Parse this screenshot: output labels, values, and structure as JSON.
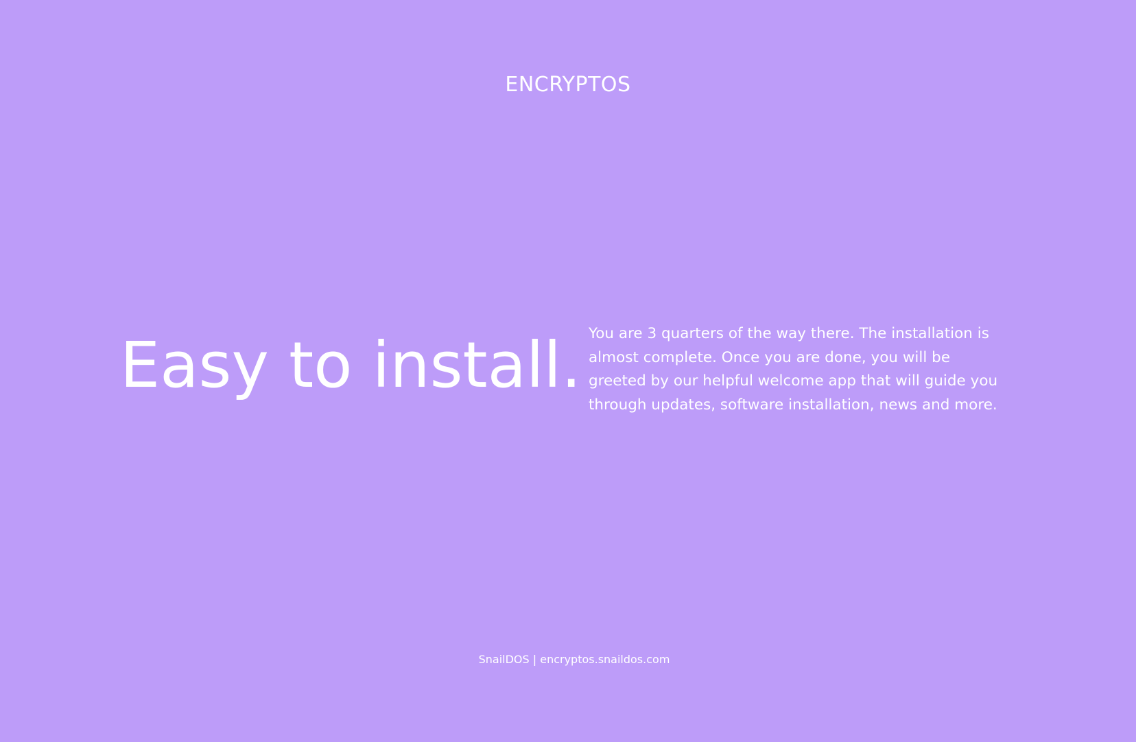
{
  "theme": {
    "background": "#bd9cf9",
    "text_color": "#ffffff"
  },
  "header": {
    "brand": "ENCRYPTOS"
  },
  "main": {
    "headline": "Easy to install.",
    "description": "You are 3 quarters of the way there. The installation is almost complete. Once you are done, you will be greeted by our helpful welcome app that will guide you through updates, software installation, news and more."
  },
  "footer": {
    "text": "SnailDOS | encryptos.snaildos.com"
  }
}
